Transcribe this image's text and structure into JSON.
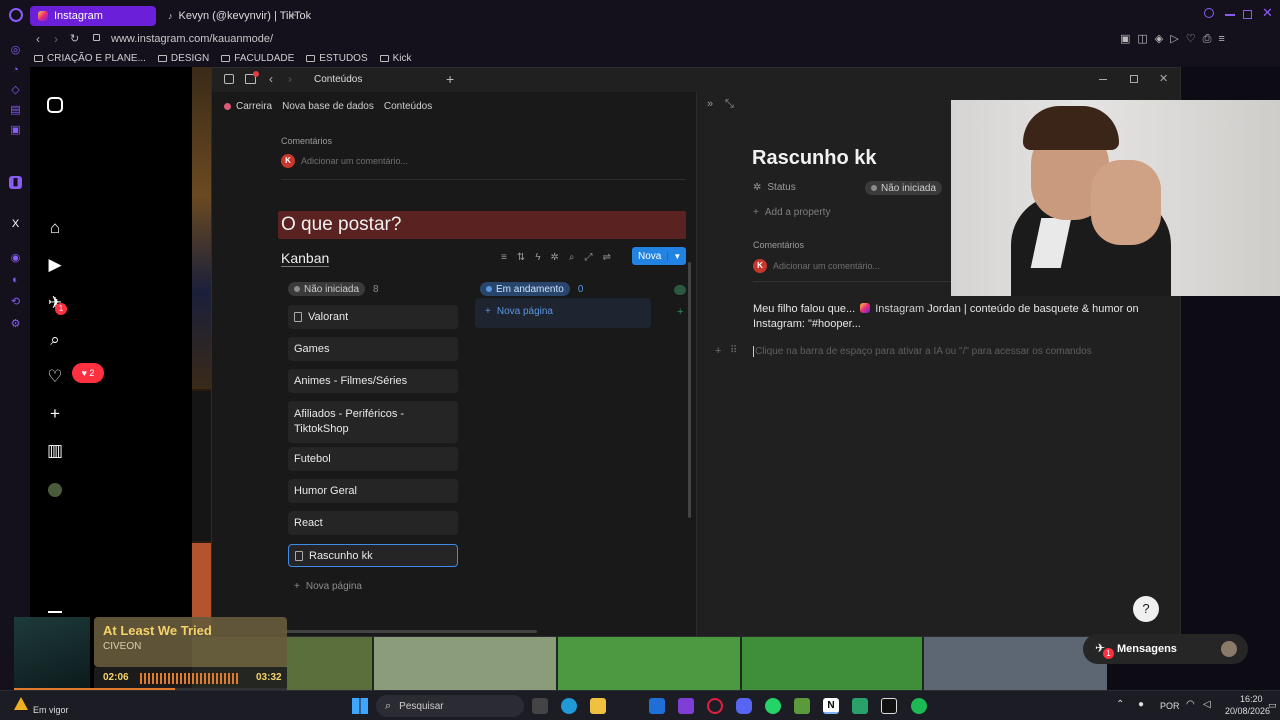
{
  "browser": {
    "tabs": [
      {
        "label": "Instagram"
      },
      {
        "label": "Kevyn (@kevynvir) | TikTok"
      }
    ],
    "new_tab": "+",
    "url": "www.instagram.com/kauanmode/",
    "bookmarks": [
      "CRIAÇÃO E PLANE...",
      "DESIGN",
      "FACULDADE",
      "ESTUDOS",
      "Kick"
    ]
  },
  "instagram": {
    "notif_badge": "1",
    "likes_badge": "2",
    "accent": "#ff3040"
  },
  "notion": {
    "window_title": "Conteúdos",
    "breadcrumb": [
      "Carreira",
      "Nova base de dados",
      "Conteúdos"
    ],
    "left": {
      "comments_label": "Comentários",
      "comment_placeholder": "Adicionar um comentário...",
      "avatar_letter": "K",
      "heading": "O que postar?",
      "view_title": "Kanban",
      "new_button": "Nova",
      "columns": [
        {
          "label": "Não iniciada",
          "count": "8"
        },
        {
          "label": "Em andamento",
          "count": "0"
        }
      ],
      "new_page": "Nova página",
      "cards": [
        "Valorant",
        "Games",
        "Animes - Filmes/Séries",
        "Afiliados - Periféricos - TiktokShop",
        "Futebol",
        "Humor Geral",
        "React",
        "Rascunho kk"
      ]
    },
    "right": {
      "page_title": "Rascunho kk",
      "status_label": "Status",
      "status_value": "Não iniciada",
      "add_property": "Add a property",
      "comments_label": "Comentários",
      "comment_placeholder": "Adicionar um comentário...",
      "avatar_letter": "K",
      "body_text_1": "Meu filho falou que...",
      "body_link": "Instagram",
      "body_text_2": "Jordan | conteúdo de basquete & humor",
      "body_text_3": "on Instagram: \"#hooper...",
      "prompt_placeholder": "Clique na barra de espaço para ativar a IA ou \"/\" para acessar os comandos"
    }
  },
  "music": {
    "title": "At Least We Tried",
    "artist": "CIVEON",
    "elapsed": "02:06",
    "duration": "03:32",
    "progress_fraction": 0.59
  },
  "messages": {
    "label": "Mensagens",
    "badge": "1"
  },
  "taskbar": {
    "weather": "Em vigor",
    "search": "Pesquisar",
    "lang": "POR",
    "time": "16:20",
    "date": "20/08/2026"
  }
}
